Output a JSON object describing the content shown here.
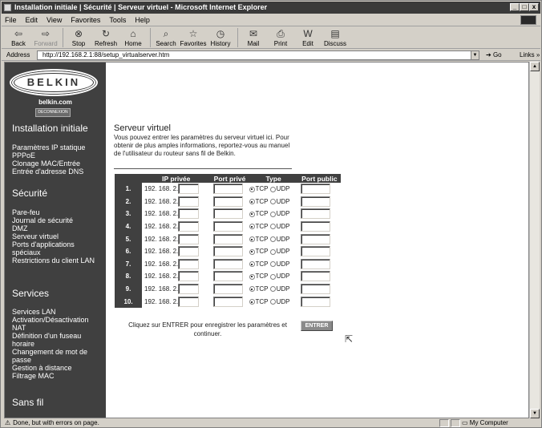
{
  "window": {
    "title": "Installation initiale | Sécurité | Serveur virtuel - Microsoft Internet Explorer",
    "controls": [
      "_",
      "□",
      "x"
    ]
  },
  "menu": [
    "File",
    "Edit",
    "View",
    "Favorites",
    "Tools",
    "Help"
  ],
  "toolbar": [
    {
      "label": "Back",
      "icon": "⇦",
      "name": "back"
    },
    {
      "label": "Forward",
      "icon": "⇨",
      "name": "forward"
    },
    {
      "label": "Stop",
      "icon": "⊗",
      "name": "stop"
    },
    {
      "label": "Refresh",
      "icon": "↻",
      "name": "refresh"
    },
    {
      "label": "Home",
      "icon": "⌂",
      "name": "home"
    },
    {
      "label": "Search",
      "icon": "⌕",
      "name": "search"
    },
    {
      "label": "Favorites",
      "icon": "☆",
      "name": "favorites"
    },
    {
      "label": "History",
      "icon": "◷",
      "name": "history"
    },
    {
      "label": "Mail",
      "icon": "✉",
      "name": "mail"
    },
    {
      "label": "Print",
      "icon": "⎙",
      "name": "print"
    },
    {
      "label": "Edit",
      "icon": "W",
      "name": "edit"
    },
    {
      "label": "Discuss",
      "icon": "▤",
      "name": "discuss"
    }
  ],
  "address": {
    "label": "Address",
    "url": "http://192.168.2.1:88/setup_virtualserver.htm",
    "go": "Go",
    "links": "Links »"
  },
  "status": {
    "text": "Done, but with errors on page.",
    "zone": "My Computer"
  },
  "sidebar": {
    "logo": "BELKIN",
    "site": "belkin.com",
    "logout": "DECONNEXION",
    "sections": [
      {
        "title": "Installation initiale",
        "links": [
          "Paramètres IP statique",
          "PPPoE",
          "Clonage MAC/Entrée",
          "Entrée d'adresse DNS"
        ]
      },
      {
        "title": "Sécurité",
        "links": [
          "Pare-feu",
          "Journal de sécurité",
          "DMZ",
          "Serveur virtuel",
          "Ports d'applications spéciaux",
          "Restrictions du client LAN"
        ]
      },
      {
        "title": "Services",
        "links": [
          "Services LAN",
          "Activation/Désactivation NAT",
          "Définition d'un fuseau horaire",
          "Changement de mot de passe",
          "Gestion à distance",
          "Filtrage MAC"
        ]
      },
      {
        "title": "Sans fil",
        "links": []
      }
    ]
  },
  "main": {
    "title": "Serveur virtuel",
    "description": "Vous pouvez entrer les paramètres du serveur virtuel ici. Pour obtenir de plus amples informations, reportez-vous au manuel de l'utilisateur du routeur sans fil de Belkin.",
    "table": {
      "headers": [
        "",
        "IP privée",
        "Port privé",
        "Type",
        "Port public"
      ],
      "ip_prefix": "192. 168. 2.",
      "rows": [
        "1.",
        "2.",
        "3.",
        "4.",
        "5.",
        "6.",
        "7.",
        "8.",
        "9.",
        "10."
      ],
      "type_options": [
        "TCP",
        "UDP"
      ],
      "selected_type": "TCP"
    },
    "footer": "Cliquez sur ENTRER pour enregistrer les paramètres et continuer.",
    "enter_button": "ENTRER"
  }
}
